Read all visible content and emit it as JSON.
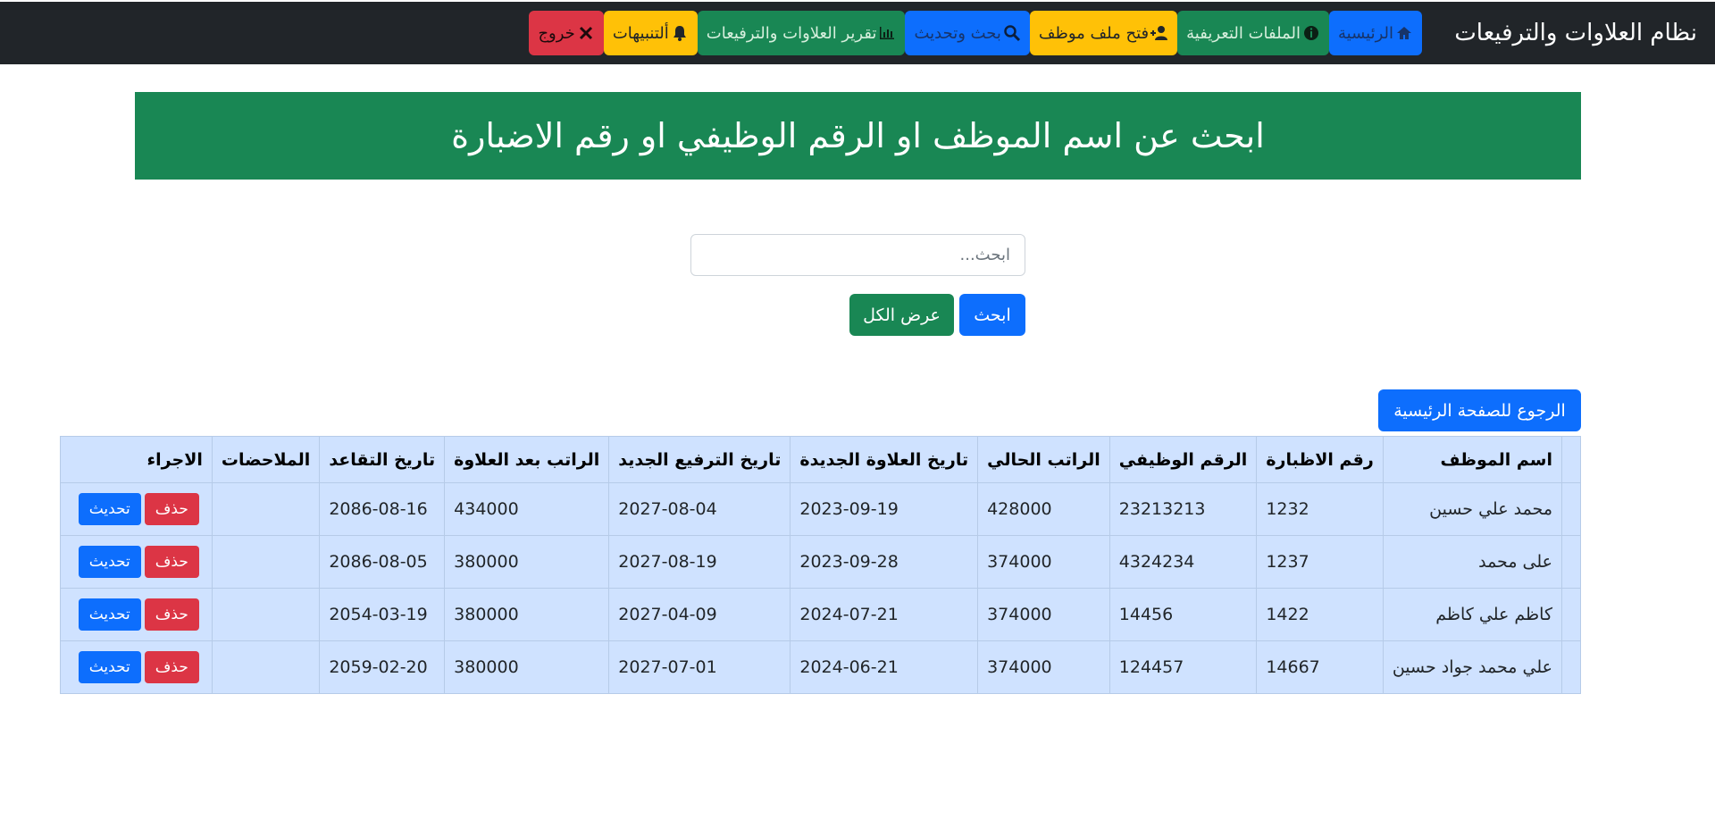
{
  "navbar": {
    "brand": "نظام العلاوات والترفيعات",
    "buttons": [
      {
        "label": "الرئيسية",
        "icon": "home-icon",
        "color": "#0d6efd"
      },
      {
        "label": "الملفات التعريفية",
        "icon": "info-icon",
        "color": "#198754"
      },
      {
        "label": "فتح ملف موظف",
        "icon": "user-plus-icon",
        "color": "#ffc107"
      },
      {
        "label": "بحث وتحديث",
        "icon": "search-icon",
        "color": "#0d6efd"
      },
      {
        "label": "تقرير العلاوات والترفيعات",
        "icon": "chart-icon",
        "color": "#198754"
      },
      {
        "label": "ألتنبيهات",
        "icon": "bell-icon",
        "color": "#ffc107"
      },
      {
        "label": "خروج",
        "icon": "close-icon",
        "color": "#dc3545"
      }
    ]
  },
  "banner": {
    "title": "ابحث عن اسم الموظف او الرقم الوظيفي او رقم الاضبارة"
  },
  "search": {
    "placeholder": "ابحث...",
    "value": "",
    "search_label": "ابحث",
    "show_all_label": "عرض الكل"
  },
  "back_button": {
    "label": "الرجوع للصفحة الرئيسية"
  },
  "table": {
    "headers": [
      "",
      "اسم الموظف",
      "رقم الاظبارة",
      "الرقم الوظيفي",
      "الراتب الحالي",
      "تاريخ العلاوة الجديدة",
      "تاريخ الترفيع الجديد",
      "الراتب بعد العلاوة",
      "تاريخ التقاعد",
      "الملاحضات",
      "الاجراء"
    ],
    "update_label": "تحديث",
    "delete_label": "حذف",
    "rows": [
      {
        "name": "محمد علي حسين",
        "file_no": "1232",
        "job_no": "23213213",
        "salary": "428000",
        "raise_date": "2023-09-19",
        "promo_date": "2027-08-04",
        "new_salary": "434000",
        "retire_date": "2086-08-16",
        "notes": ""
      },
      {
        "name": "على محمد",
        "file_no": "1237",
        "job_no": "4324234",
        "salary": "374000",
        "raise_date": "2023-09-28",
        "promo_date": "2027-08-19",
        "new_salary": "380000",
        "retire_date": "2086-08-05",
        "notes": ""
      },
      {
        "name": "كاظم علي كاظم",
        "file_no": "1422",
        "job_no": "14456",
        "salary": "374000",
        "raise_date": "2024-07-21",
        "promo_date": "2027-04-09",
        "new_salary": "380000",
        "retire_date": "2054-03-19",
        "notes": ""
      },
      {
        "name": "علي محمد جواد حسين",
        "file_no": "14667",
        "job_no": "124457",
        "salary": "374000",
        "raise_date": "2024-06-21",
        "promo_date": "2027-07-01",
        "new_salary": "380000",
        "retire_date": "2059-02-20",
        "notes": ""
      }
    ]
  }
}
